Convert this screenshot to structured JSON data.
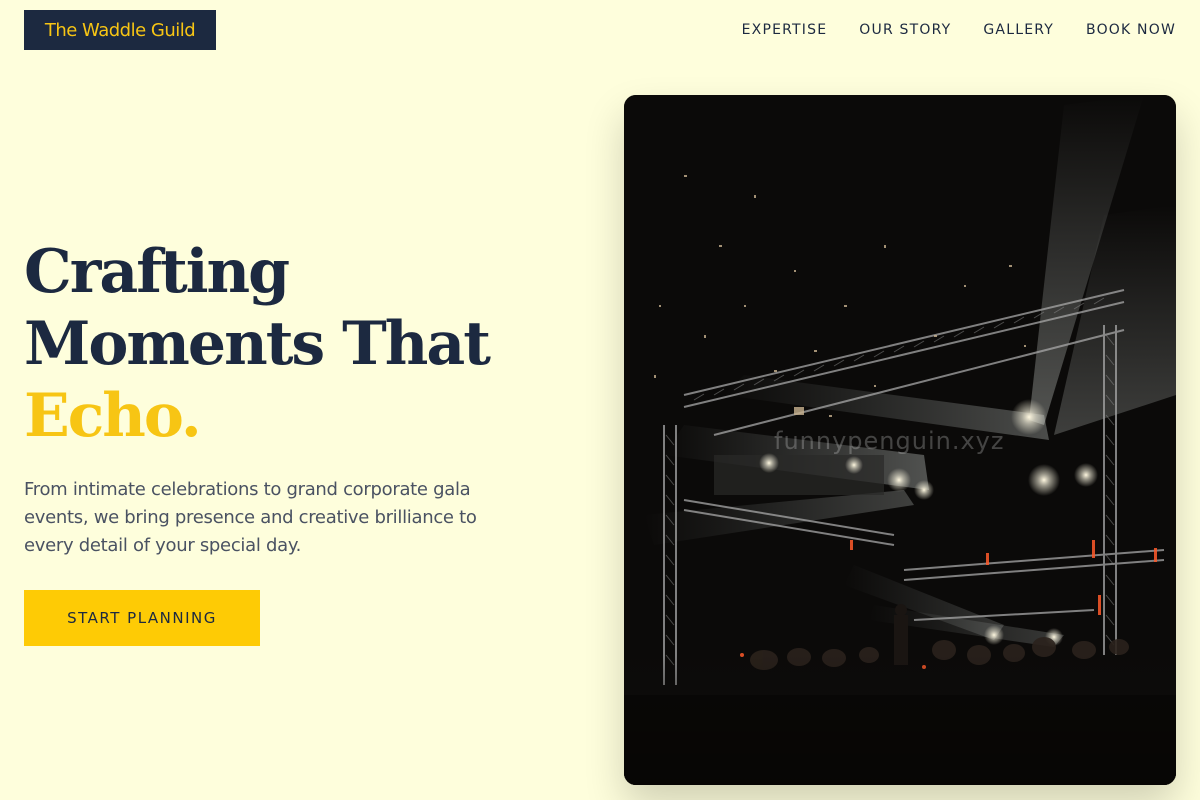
{
  "brand": {
    "name": "The Waddle Guild"
  },
  "nav": {
    "items": [
      {
        "label": "EXPERTISE"
      },
      {
        "label": "OUR STORY"
      },
      {
        "label": "GALLERY"
      },
      {
        "label": "BOOK NOW"
      }
    ]
  },
  "hero": {
    "title_line1": "Crafting",
    "title_line2": "Moments That",
    "title_accent": "Echo.",
    "subtitle": "From intimate celebrations to grand corporate gala events, we bring presence and creative brilliance to every detail of your special day.",
    "cta_label": "START PLANNING",
    "image_watermark": "funnypenguin.xyz"
  },
  "colors": {
    "background": "#fefedc",
    "navy": "#1c2940",
    "accent_yellow": "#fecb05",
    "subtitle_gray": "#4a5262"
  }
}
